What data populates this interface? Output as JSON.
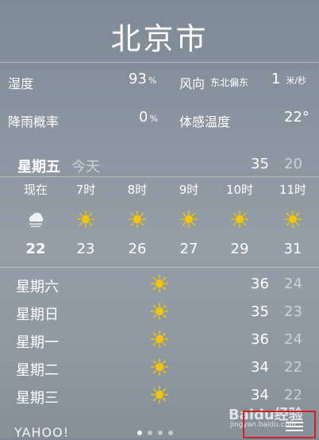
{
  "city": "北京市",
  "details": [
    {
      "label": "湿度",
      "value": "93",
      "unit": "%"
    },
    {
      "label": "风向",
      "sub": "东北偏东",
      "value": "1",
      "unit": "米/秒"
    },
    {
      "label": "降雨概率",
      "value": "0",
      "unit": "%"
    },
    {
      "label": "体感温度",
      "value": "22°"
    }
  ],
  "today": {
    "day": "星期五",
    "label": "今天",
    "high": "35",
    "low": "20"
  },
  "hourly": [
    {
      "time": "现在",
      "icon": "cloud-icon",
      "temp": "22"
    },
    {
      "time": "7时",
      "icon": "sun-icon",
      "temp": "23"
    },
    {
      "time": "8时",
      "icon": "sun-icon",
      "temp": "26"
    },
    {
      "time": "9时",
      "icon": "sun-icon",
      "temp": "27"
    },
    {
      "time": "10时",
      "icon": "sun-icon",
      "temp": "29"
    },
    {
      "time": "11时",
      "icon": "sun-icon",
      "temp": "31"
    }
  ],
  "daily": [
    {
      "day": "星期六",
      "icon": "sun-icon",
      "high": "36",
      "low": "24"
    },
    {
      "day": "星期日",
      "icon": "sun-icon",
      "high": "35",
      "low": "23"
    },
    {
      "day": "星期一",
      "icon": "sun-icon",
      "high": "36",
      "low": "24"
    },
    {
      "day": "星期二",
      "icon": "sun-icon",
      "high": "34",
      "low": "22"
    },
    {
      "day": "星期三",
      "icon": "sun-icon",
      "high": "34",
      "low": "22"
    }
  ],
  "footer": {
    "brand": "YAHOO!"
  },
  "watermark": {
    "text": "Baidu经验",
    "url": "jingyan.baidu.com"
  },
  "colors": {
    "sun": "#f5c400",
    "highlight_box": "#d62020"
  }
}
